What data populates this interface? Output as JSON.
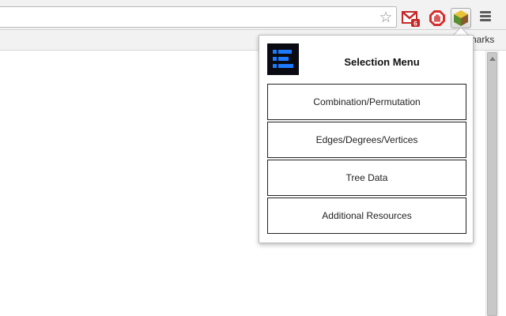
{
  "browser": {
    "bookmarks_bar_text": "harks",
    "star_icon": "star-icon",
    "extensions": [
      {
        "name": "gmail-checker",
        "badge": "6",
        "color": "#c62828"
      },
      {
        "name": "adblock-stop",
        "color": "#d32f2f"
      },
      {
        "name": "selection-menu-extension",
        "color": "#6a9a2a"
      }
    ]
  },
  "popup": {
    "title": "Selection Menu",
    "logo_colors": {
      "background": "#0a0a12",
      "accent": "#1e7bff"
    },
    "options": [
      {
        "label": "Combination/Permutation"
      },
      {
        "label": "Edges/Degrees/Vertices"
      },
      {
        "label": "Tree Data"
      },
      {
        "label": "Additional Resources"
      }
    ]
  }
}
